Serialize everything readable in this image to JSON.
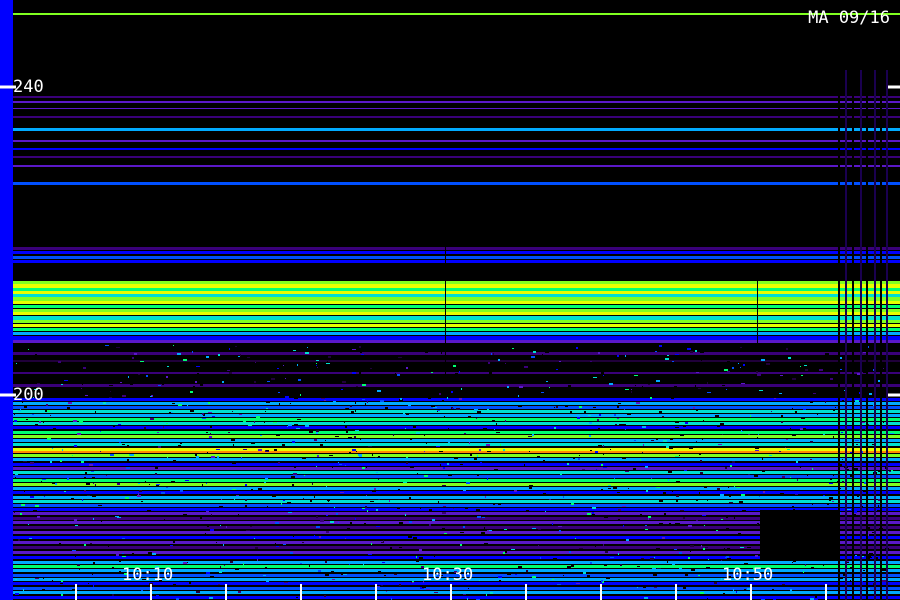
{
  "station_label": "MA 09/16",
  "y_axis": {
    "ticks": [
      "240",
      "200"
    ]
  },
  "x_axis": {
    "ticks": [
      "10:10",
      "10:30",
      "10:50"
    ]
  },
  "colors": {
    "background": "#000000",
    "left_edge_bar": "#0000ff",
    "text": "#ffffff",
    "palette": [
      "#20003a",
      "#3a007a",
      "#5a18c8",
      "#0000ff",
      "#0050ff",
      "#00aaff",
      "#00e0d0",
      "#00ff70",
      "#80ff20",
      "#e8ff00",
      "#ff8a00"
    ]
  }
}
